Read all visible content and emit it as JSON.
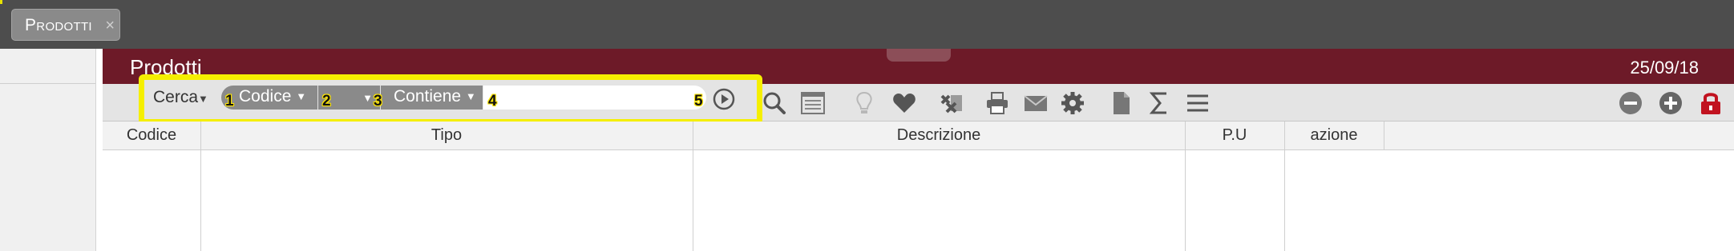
{
  "tabs": [
    {
      "label": "Prodotti",
      "close": "×"
    }
  ],
  "header": {
    "title": "Prodotti",
    "date": "25/09/18"
  },
  "search": {
    "cerca_label": "Cerca",
    "field_label": "Codice",
    "second_label": "",
    "operator_label": "Contiene",
    "value": "",
    "annotations": [
      "1",
      "2",
      "3",
      "4",
      "5"
    ],
    "highlight_color": "#f5ef00"
  },
  "toolbar": {
    "icons": [
      "search-icon",
      "list-view-icon",
      "lightbulb-icon",
      "heart-icon",
      "excel-icon",
      "print-icon",
      "mail-icon",
      "gear-icon",
      "document-icon",
      "sigma-icon",
      "menu-icon"
    ],
    "right_icons": [
      "remove-icon",
      "add-icon",
      "lock-icon"
    ]
  },
  "table": {
    "columns": [
      "Codice",
      "Tipo",
      "Descrizione",
      "P.U",
      "azione",
      ""
    ]
  },
  "colors": {
    "header_bg": "#6d1a28",
    "tabstrip_bg": "#4d4d4d",
    "tab_bg": "#8a8a8a",
    "lock": "#c1121f"
  }
}
